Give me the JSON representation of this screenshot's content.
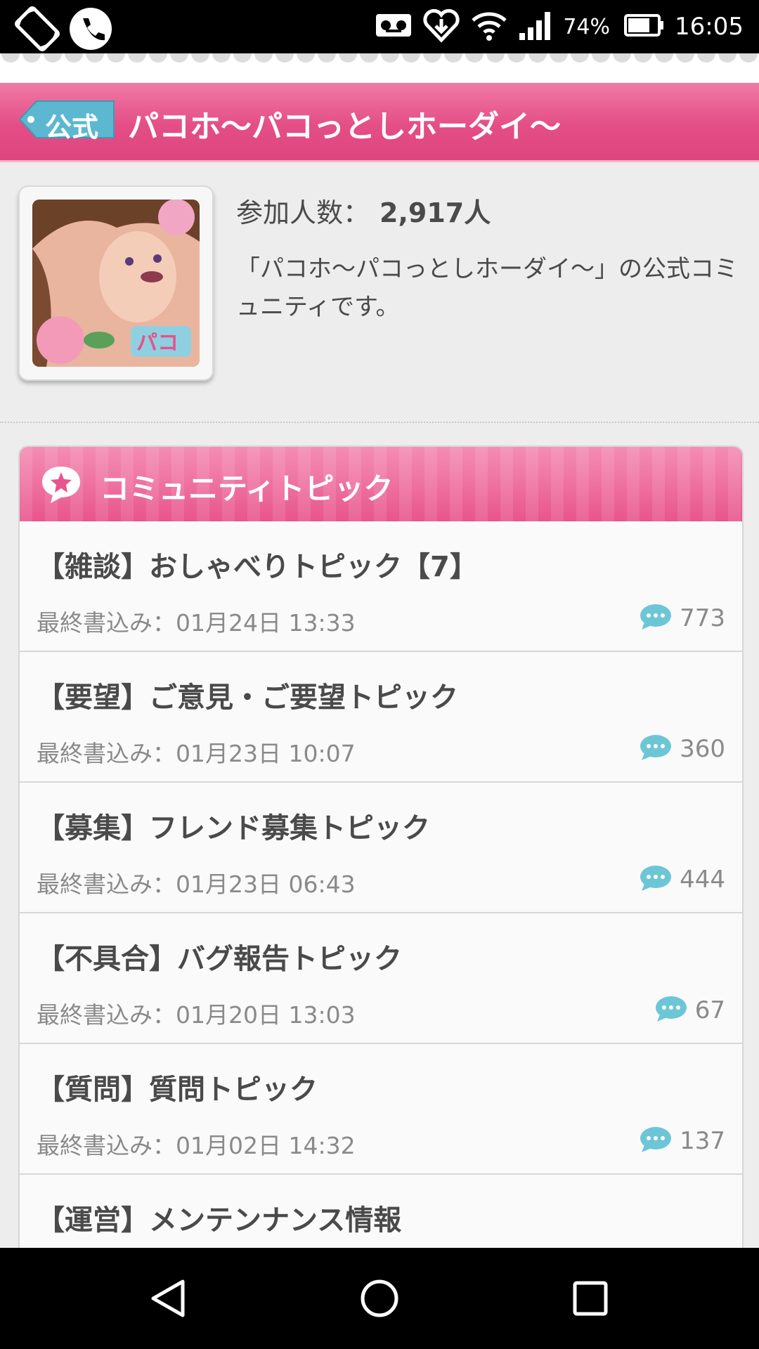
{
  "status_bar": {
    "battery_percent": "74%",
    "time": "16:05",
    "icons": [
      "rotate-icon",
      "call-icon",
      "voicemail-icon",
      "heart-download-icon",
      "wifi-icon",
      "signal-icon",
      "battery-icon"
    ]
  },
  "header": {
    "tag": "公式",
    "title": "パコホ〜パコっとしホーダイ〜"
  },
  "community": {
    "members_label": "参加人数：",
    "members_count": "2,917人",
    "description": "「パコホ〜パコっとしホーダイ〜」の公式コミュニティです。"
  },
  "topics_panel": {
    "title": "コミュニティトピック",
    "topics": [
      {
        "title": "【雑談】おしゃべりトピック【7】",
        "last_post": "最終書込み：01月24日 13:33",
        "count": "773"
      },
      {
        "title": "【要望】ご意見・ご要望トピック",
        "last_post": "最終書込み：01月23日 10:07",
        "count": "360"
      },
      {
        "title": "【募集】フレンド募集トピック",
        "last_post": "最終書込み：01月23日 06:43",
        "count": "444"
      },
      {
        "title": "【不具合】バグ報告トピック",
        "last_post": "最終書込み：01月20日 13:03",
        "count": "67"
      },
      {
        "title": "【質問】質問トピック",
        "last_post": "最終書込み：01月02日 14:32",
        "count": "137"
      },
      {
        "title": "【運営】メンテンナンス情報",
        "last_post": "",
        "count": ""
      }
    ]
  },
  "colors": {
    "header_pink": "#e44e86",
    "tag_blue": "#5bb8d0",
    "comment_icon": "#6cc6d6"
  }
}
